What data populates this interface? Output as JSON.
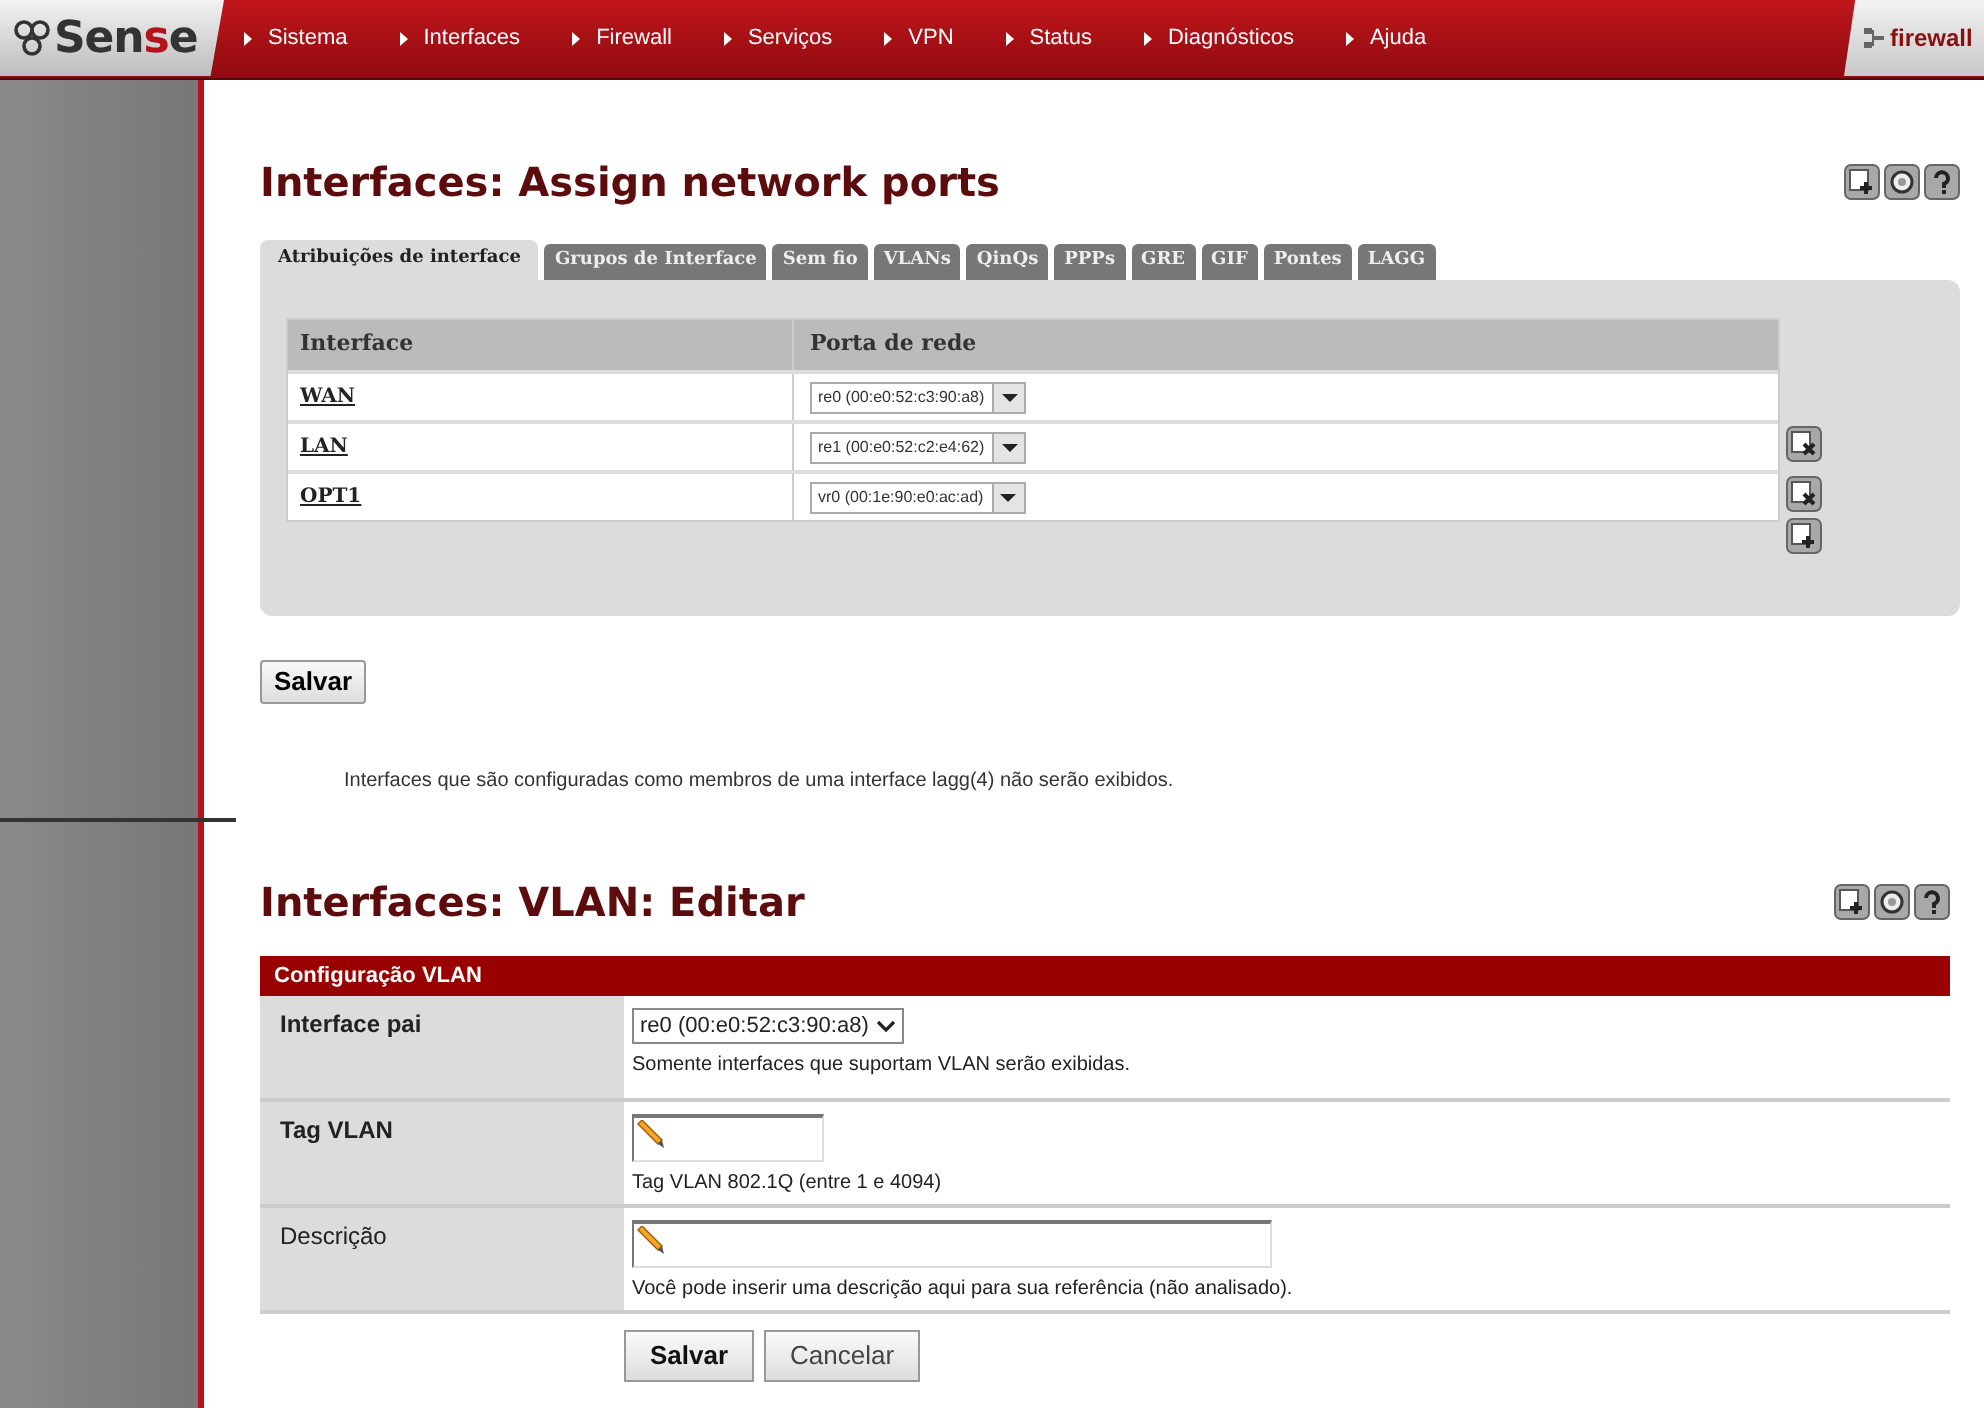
{
  "logo": [
    {
      "text": "Sen",
      "accent": false
    },
    {
      "text": "s",
      "accent": true
    },
    {
      "text": "e",
      "accent": false
    }
  ],
  "nav": [
    "Sistema",
    "Interfaces",
    "Firewall",
    "Serviços",
    "VPN",
    "Status",
    "Diagnósticos",
    "Ajuda"
  ],
  "host": "firewall",
  "assign": {
    "title": "Interfaces: Assign network ports",
    "tabs": [
      {
        "label": "Atribuições de interface",
        "selected": true
      },
      {
        "label": "Grupos de Interface",
        "selected": false
      },
      {
        "label": "Sem fio",
        "selected": false
      },
      {
        "label": "VLANs",
        "selected": false
      },
      {
        "label": "QinQs",
        "selected": false
      },
      {
        "label": "PPPs",
        "selected": false
      },
      {
        "label": "GRE",
        "selected": false
      },
      {
        "label": "GIF",
        "selected": false
      },
      {
        "label": "Pontes",
        "selected": false
      },
      {
        "label": "LAGG",
        "selected": false
      }
    ],
    "columns": [
      "Interface",
      "Porta de rede"
    ],
    "rows": [
      {
        "interface": "WAN",
        "port": "re0 (00:e0:52:c3:90:a8)",
        "removable": false
      },
      {
        "interface": "LAN",
        "port": "re1 (00:e0:52:c2:e4:62)",
        "removable": true
      },
      {
        "interface": "OPT1",
        "port": "vr0 (00:1e:90:e0:ac:ad)",
        "removable": true
      }
    ],
    "save": "Salvar",
    "note": "Interfaces que são configuradas como membros de uma interface lagg(4) não serão exibidos."
  },
  "vlan": {
    "title": "Interfaces: VLAN: Editar",
    "header": "Configuração VLAN",
    "fields": [
      {
        "label": "Interface pai",
        "bold": true,
        "kind": "select",
        "value": "re0 (00:e0:52:c3:90:a8)",
        "hint": "Somente interfaces que suportam VLAN serão exibidas."
      },
      {
        "label": "Tag VLAN",
        "bold": true,
        "kind": "short",
        "hint": "Tag VLAN 802.1Q (entre 1 e 4094)"
      },
      {
        "label": "Descrição",
        "bold": false,
        "kind": "long",
        "hint": "Você pode inserir uma descrição aqui para sua referência (não analisado)."
      }
    ],
    "buttons": [
      {
        "label": "Salvar",
        "primary": true
      },
      {
        "label": "Cancelar",
        "primary": false
      }
    ]
  }
}
